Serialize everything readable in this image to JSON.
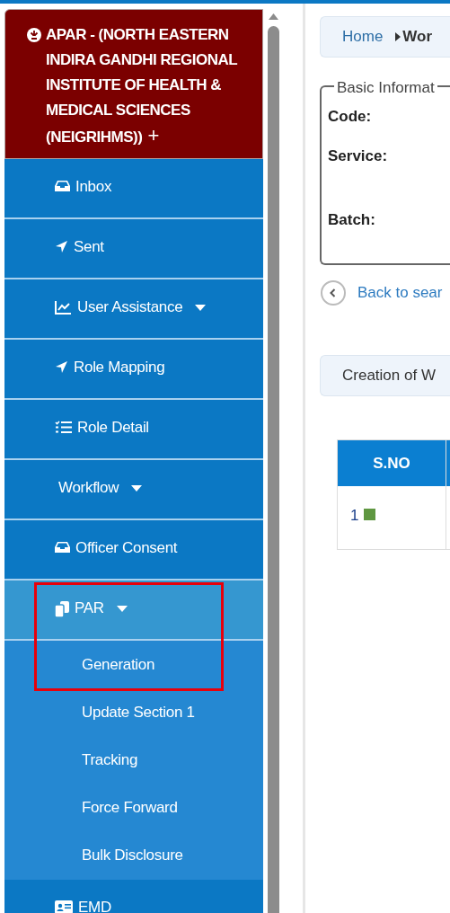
{
  "sidebar": {
    "header": {
      "title": "APAR - (NORTH EASTERN INDIRA GANDHI REGIONAL INSTITUTE OF HEALTH & MEDICAL SCIENCES (NEIGRIHMS))",
      "expand_symbol": "+"
    },
    "items": [
      {
        "label": "Inbox",
        "dropdown": false,
        "expanded": false
      },
      {
        "label": "Sent",
        "dropdown": false,
        "expanded": false
      },
      {
        "label": "User Assistance",
        "dropdown": true,
        "expanded": false
      },
      {
        "label": "Role Mapping",
        "dropdown": false,
        "expanded": false
      },
      {
        "label": "Role Detail",
        "dropdown": false,
        "expanded": false
      },
      {
        "label": "Workflow",
        "dropdown": true,
        "expanded": false
      },
      {
        "label": "Officer Consent",
        "dropdown": false,
        "expanded": false
      },
      {
        "label": "PAR",
        "dropdown": true,
        "expanded": true,
        "highlighted": true,
        "children": [
          {
            "label": "Generation"
          },
          {
            "label": "Update Section 1"
          },
          {
            "label": "Tracking"
          },
          {
            "label": "Force Forward"
          },
          {
            "label": "Bulk Disclosure"
          }
        ]
      },
      {
        "label": "EMD",
        "dropdown": false,
        "expanded": false
      }
    ]
  },
  "breadcrumb": [
    "Home",
    "Wor"
  ],
  "basic_information": {
    "legend": "Basic Informat",
    "fields": [
      "Code:",
      "Service:",
      "Batch:"
    ]
  },
  "back_link": "Back to sear",
  "section_title": "Creation of W",
  "table": {
    "columns": [
      "S.NO"
    ],
    "rows": [
      {
        "cells": [
          "1"
        ],
        "color": "#5f9741"
      }
    ]
  }
}
